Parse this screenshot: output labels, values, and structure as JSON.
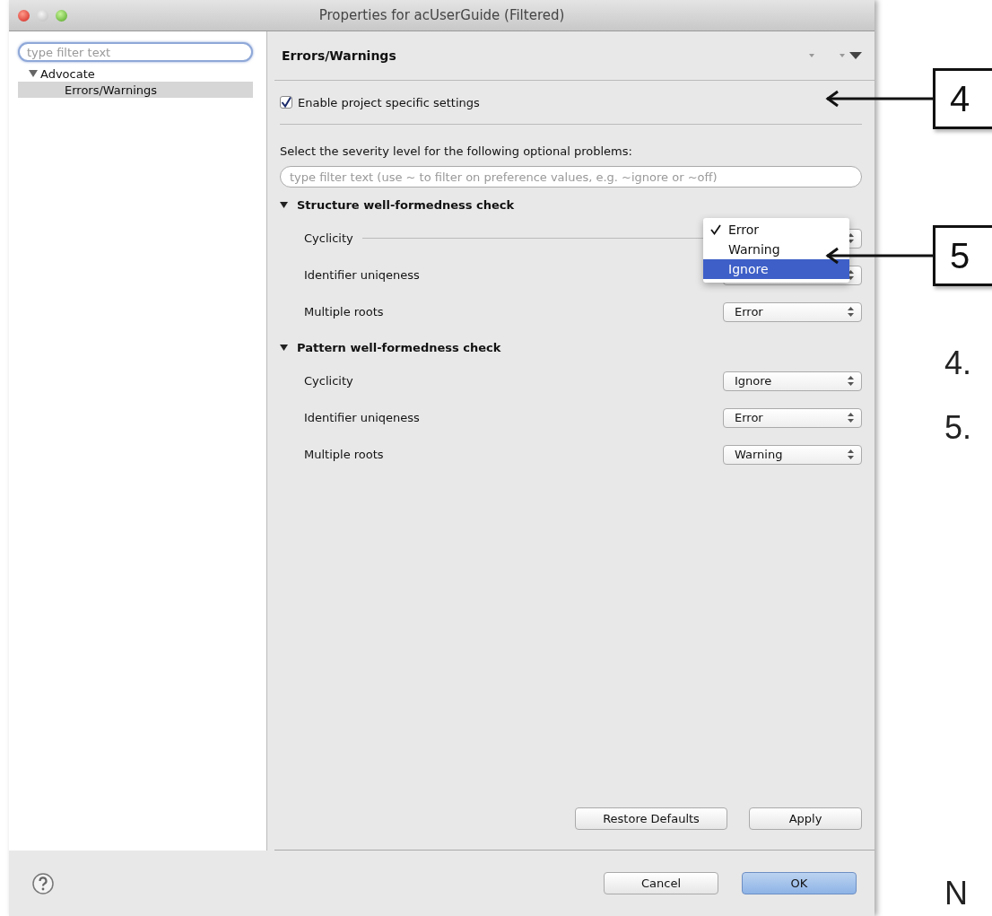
{
  "window": {
    "title": "Properties for acUserGuide (Filtered)"
  },
  "sidebar": {
    "filter": {
      "placeholder": "type filter text"
    },
    "tree": [
      {
        "label": "Advocate",
        "expanded": true,
        "selected": false,
        "children": [
          {
            "label": "Errors/Warnings",
            "selected": true
          }
        ]
      }
    ]
  },
  "page": {
    "title": "Errors/Warnings",
    "enable_checkbox": {
      "label": "Enable project specific settings",
      "checked": true
    },
    "intro": "Select the severity level for the following optional problems:",
    "filter": {
      "placeholder": "type filter text (use ~ to filter on preference values, e.g. ~ignore or ~off)"
    },
    "sections": [
      {
        "title": "Structure well-formedness check",
        "expanded": true,
        "rows": [
          {
            "label": "Cyclicity",
            "menu": [
              {
                "label": "Error",
                "checked": true,
                "selected": false
              },
              {
                "label": "Warning",
                "checked": false,
                "selected": false
              },
              {
                "label": "Ignore",
                "checked": false,
                "selected": true
              }
            ]
          },
          {
            "label": "Identifier uniqeness"
          },
          {
            "label": "Multiple roots",
            "value": "Error"
          }
        ]
      },
      {
        "title": "Pattern well-formedness check",
        "expanded": true,
        "rows": [
          {
            "label": "Cyclicity",
            "value": "Ignore"
          },
          {
            "label": "Identifier uniqeness",
            "value": "Error"
          },
          {
            "label": "Multiple roots",
            "value": "Warning"
          }
        ]
      }
    ],
    "buttons": [
      "Restore Defaults",
      "Apply"
    ]
  },
  "footer": {
    "buttons": [
      {
        "label": "Cancel",
        "default": false
      },
      {
        "label": "OK",
        "default": true
      }
    ]
  },
  "annotations": {
    "callouts": [
      {
        "label": "4"
      },
      {
        "label": "5"
      }
    ],
    "notes": [
      "4.",
      "5.",
      "N"
    ]
  }
}
